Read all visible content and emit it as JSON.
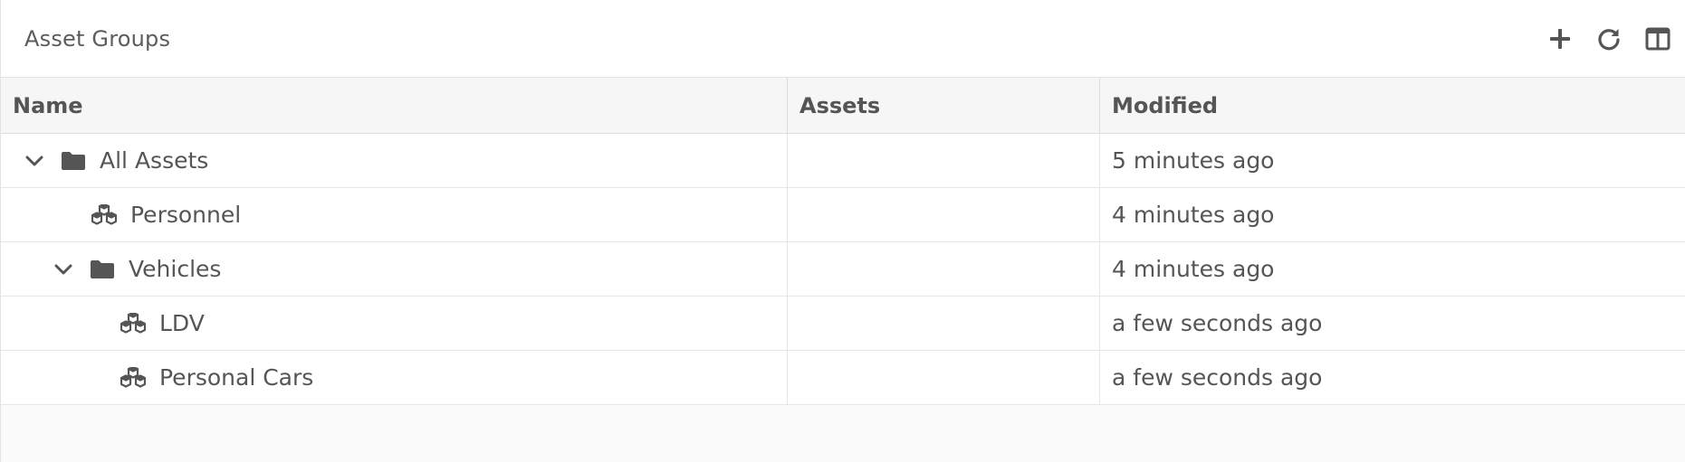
{
  "panel": {
    "title": "Asset Groups",
    "tools": [
      {
        "icon": "plus-icon"
      },
      {
        "icon": "refresh-icon"
      },
      {
        "icon": "columns-icon"
      }
    ]
  },
  "table": {
    "columns": [
      "Name",
      "Assets",
      "Modified"
    ],
    "rows": [
      {
        "name": "All Assets",
        "type": "folder",
        "expanded": true,
        "assets": "",
        "modified": "5 minutes ago"
      },
      {
        "name": "Personnel",
        "type": "group",
        "assets": "",
        "modified": "4 minutes ago"
      },
      {
        "name": "Vehicles",
        "type": "folder",
        "expanded": true,
        "assets": "",
        "modified": "4 minutes ago"
      },
      {
        "name": "LDV",
        "type": "group",
        "assets": "",
        "modified": "a few seconds ago"
      },
      {
        "name": "Personal Cars",
        "type": "group",
        "assets": "",
        "modified": "a few seconds ago"
      }
    ]
  },
  "colors": {
    "icon": "#555555",
    "header_bg": "#f6f6f6",
    "row_bg": "#ffffff",
    "border": "#e3e3e3"
  }
}
